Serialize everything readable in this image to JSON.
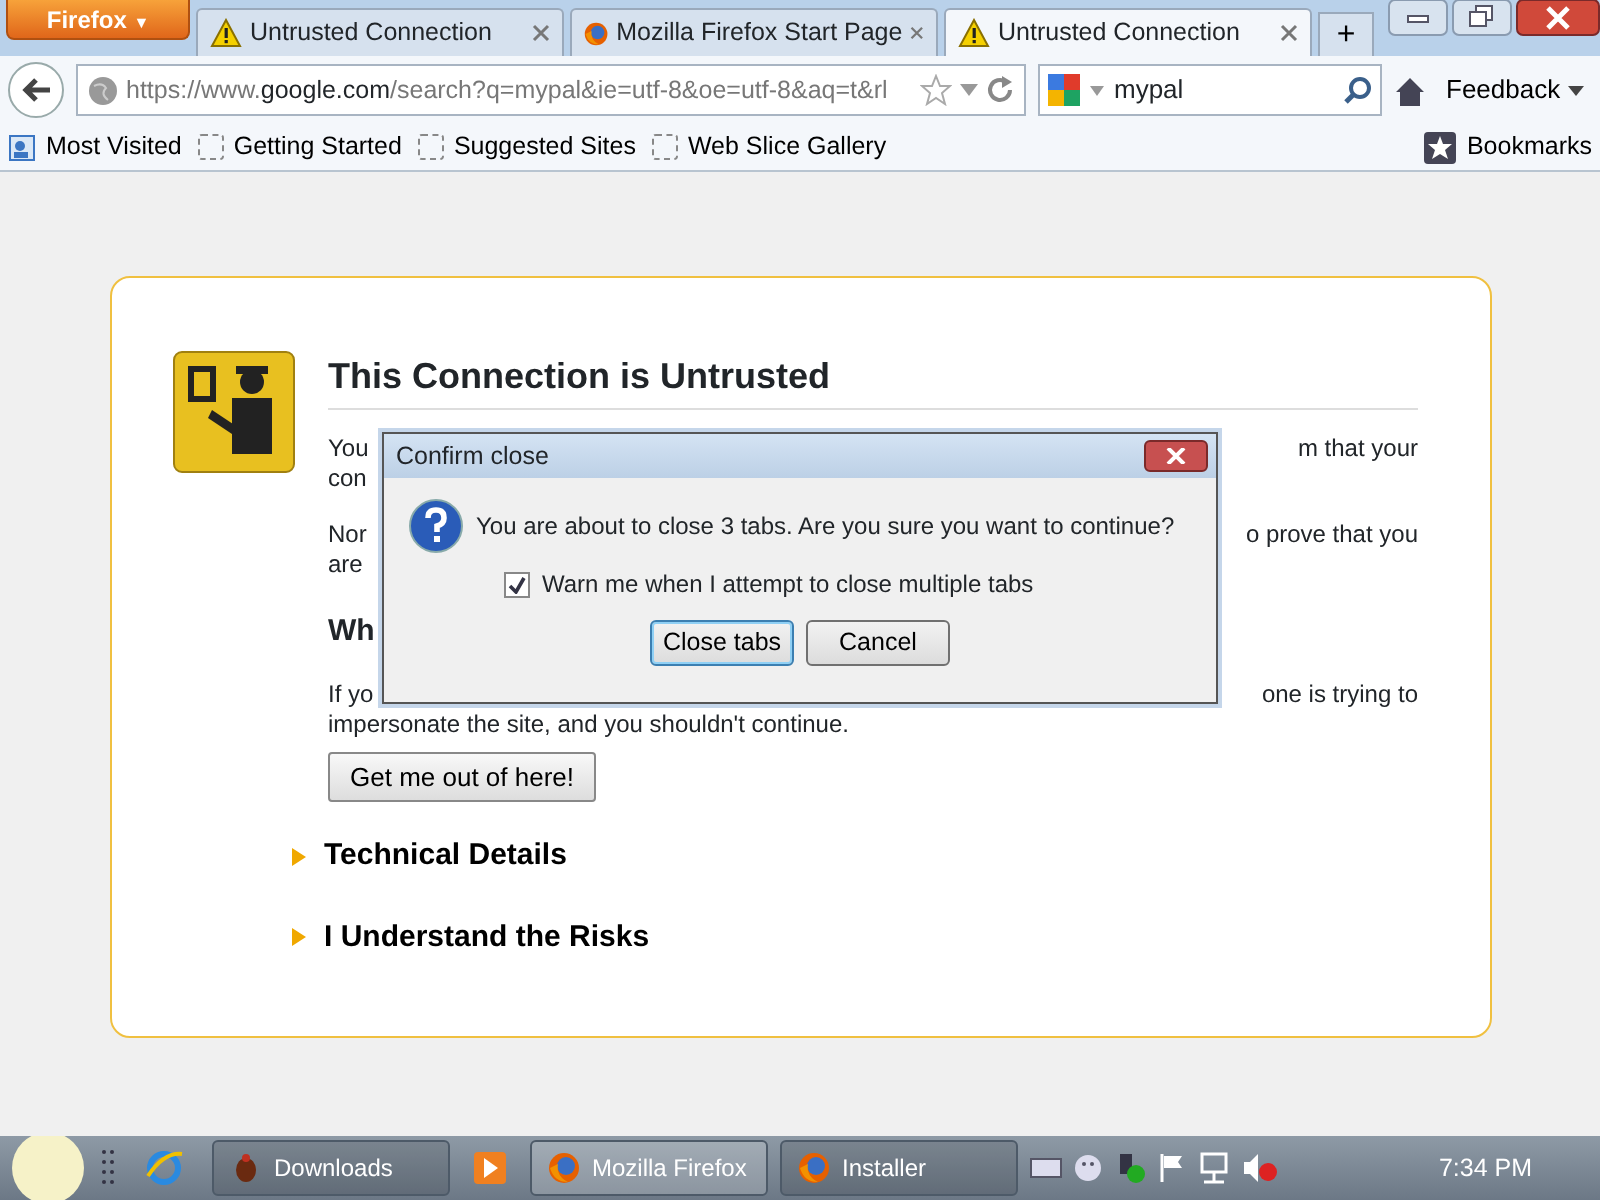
{
  "app_button": {
    "label": "Firefox",
    "caret": "▼"
  },
  "tabs": [
    {
      "title": "Untrusted Connection",
      "kind": "warning",
      "selected": false
    },
    {
      "title": "Mozilla Firefox Start Page",
      "kind": "firefox",
      "selected": false
    },
    {
      "title": "Untrusted Connection",
      "kind": "warning",
      "selected": true
    }
  ],
  "new_tab": "+",
  "address_bar": {
    "prefix": "https://www.",
    "domain": "google.com",
    "rest": "/search?q=mypal&ie=utf-8&oe=utf-8&aq=t&rl"
  },
  "search_field": {
    "value": "mypal"
  },
  "feedback_button": "Feedback",
  "bookmarks_bar": {
    "items": [
      {
        "label": "Most Visited",
        "kind": "folder"
      },
      {
        "label": "Getting Started",
        "kind": "page"
      },
      {
        "label": "Suggested Sites",
        "kind": "page"
      },
      {
        "label": "Web Slice Gallery",
        "kind": "page"
      }
    ],
    "menu": "Bookmarks"
  },
  "page": {
    "title": "This Connection is Untrusted",
    "paragraphs": [
      [
        {
          "left": "You",
          "right": "m that your"
        },
        {
          "left": "con"
        }
      ],
      [
        {
          "left": "Nor",
          "right": "o prove that you"
        },
        {
          "left": "are"
        }
      ]
    ],
    "heading": "Wh",
    "paragraphs2": [
      [
        {
          "left": "If yo",
          "right": "one is trying to"
        }
      ]
    ],
    "last_line": "impersonate the site, and you shouldn't continue.",
    "button": "Get me out of here!",
    "sections": [
      {
        "label": "Technical Details",
        "expanded": false
      },
      {
        "label": "I Understand the Risks",
        "expanded": false
      }
    ]
  },
  "dialog": {
    "title": "Confirm close",
    "message": "You are about to close 3 tabs. Are you sure you want to continue?",
    "checkbox": {
      "label": "Warn me when I attempt to close multiple tabs",
      "checked": true
    },
    "buttons": [
      {
        "label": "Close tabs",
        "default": true
      },
      {
        "label": "Cancel",
        "default": false
      }
    ]
  },
  "taskbar": {
    "items": [
      {
        "kind": "browser"
      },
      {
        "kind": "downloads",
        "label": "Downloads",
        "active": false
      },
      {
        "kind": "media"
      },
      {
        "kind": "firefox",
        "label": "Mozilla Firefox",
        "active": true
      },
      {
        "kind": "firefox",
        "label": "Installer",
        "active": false
      }
    ],
    "clock": "7:34 PM"
  }
}
